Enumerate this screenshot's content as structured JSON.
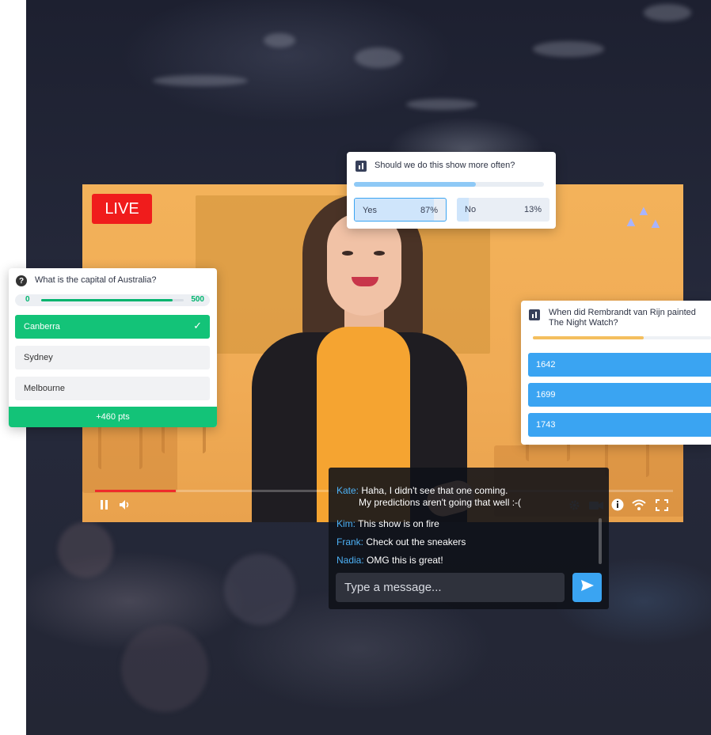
{
  "video": {
    "live_label": "LIVE",
    "progress_fraction": 0.14
  },
  "poll_top": {
    "question": "Should we do this show more often?",
    "bar_fraction": 0.64,
    "options": [
      {
        "label": "Yes",
        "percent": "87%",
        "value": 87
      },
      {
        "label": "No",
        "percent": "13%",
        "value": 13
      }
    ],
    "accent": "#3aa4f2"
  },
  "quiz": {
    "question": "What is the capital of Australia?",
    "range_min": "0",
    "range_max": "500",
    "range_fraction": 0.92,
    "options": [
      {
        "label": "Canberra",
        "correct": true
      },
      {
        "label": "Sydney",
        "correct": false
      },
      {
        "label": "Melbourne",
        "correct": false
      }
    ],
    "score": "+460 pts",
    "accent": "#13c378"
  },
  "poll_right": {
    "question": "When did Rembrandt van Rijn painted The Night Watch?",
    "bar_fraction": 0.62,
    "bar_color": "#f4bf5e",
    "options": [
      "1642",
      "1699",
      "1743"
    ]
  },
  "chat": {
    "messages": [
      {
        "user": "Kate:",
        "text": "Haha, I didn't see that one coming.",
        "text2": "My predictions aren't going that well :-("
      },
      {
        "user": "Kim:",
        "text": "This show is on fire"
      },
      {
        "user": "Frank:",
        "text": "Check out the sneakers"
      },
      {
        "user": "Nadia:",
        "text": "OMG this is great!"
      }
    ],
    "input_placeholder": "Type a message...",
    "user_color": "#4db1f5"
  },
  "icons": {
    "pause": "pause-icon",
    "volume": "volume-icon",
    "settings": "gear-icon",
    "camera": "camera-icon",
    "info": "info-icon",
    "signal": "wifi-icon",
    "fullscreen": "fullscreen-icon",
    "send": "send-icon"
  }
}
